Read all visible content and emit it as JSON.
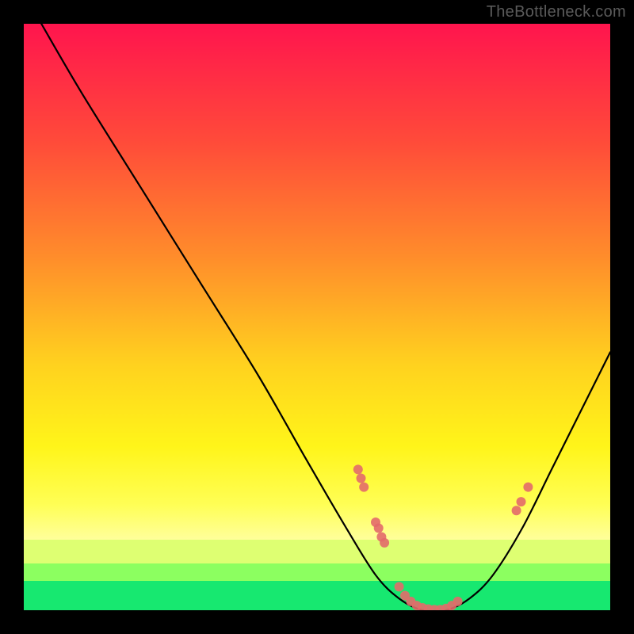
{
  "watermark": "TheBottleneck.com",
  "chart_data": {
    "type": "line",
    "title": "",
    "xlabel": "",
    "ylabel": "",
    "xlim": [
      0,
      100
    ],
    "ylim": [
      0,
      100
    ],
    "grid": false,
    "legend": false,
    "series": [
      {
        "name": "bottleneck-curve",
        "x": [
          3,
          10,
          20,
          30,
          40,
          48,
          55,
          60,
          64,
          68,
          72,
          76,
          80,
          85,
          90,
          95,
          100
        ],
        "y": [
          100,
          88,
          72,
          56,
          40,
          26,
          14,
          6,
          2,
          0,
          0,
          2,
          6,
          14,
          24,
          34,
          44
        ]
      }
    ],
    "markers": [
      {
        "x": 57,
        "y": 24
      },
      {
        "x": 57.5,
        "y": 22.5
      },
      {
        "x": 58,
        "y": 21
      },
      {
        "x": 60,
        "y": 15
      },
      {
        "x": 60.5,
        "y": 14
      },
      {
        "x": 61,
        "y": 12.5
      },
      {
        "x": 61.5,
        "y": 11.5
      },
      {
        "x": 64,
        "y": 4
      },
      {
        "x": 65,
        "y": 2.5
      },
      {
        "x": 66,
        "y": 1.5
      },
      {
        "x": 67,
        "y": 0.8
      },
      {
        "x": 68,
        "y": 0.4
      },
      {
        "x": 69,
        "y": 0.2
      },
      {
        "x": 70,
        "y": 0.1
      },
      {
        "x": 71,
        "y": 0.1
      },
      {
        "x": 72,
        "y": 0.3
      },
      {
        "x": 73,
        "y": 0.8
      },
      {
        "x": 74,
        "y": 1.5
      },
      {
        "x": 84,
        "y": 17
      },
      {
        "x": 84.8,
        "y": 18.5
      },
      {
        "x": 86,
        "y": 21
      }
    ],
    "gradient_stops": [
      {
        "offset": 0,
        "color": "#ff154e"
      },
      {
        "offset": 0.2,
        "color": "#ff4b3a"
      },
      {
        "offset": 0.4,
        "color": "#ff8e2b"
      },
      {
        "offset": 0.58,
        "color": "#ffd21f"
      },
      {
        "offset": 0.72,
        "color": "#fff51a"
      },
      {
        "offset": 0.82,
        "color": "#ffff56"
      },
      {
        "offset": 0.88,
        "color": "#ffff9c"
      }
    ],
    "green_bands": [
      {
        "top_pct": 88.0,
        "height_pct": 4.0,
        "color": "#d8ff6b",
        "alpha": 0.85
      },
      {
        "top_pct": 92.0,
        "height_pct": 3.0,
        "color": "#7fff5a",
        "alpha": 0.9
      },
      {
        "top_pct": 95.0,
        "height_pct": 5.0,
        "color": "#17e870",
        "alpha": 1.0
      }
    ]
  }
}
